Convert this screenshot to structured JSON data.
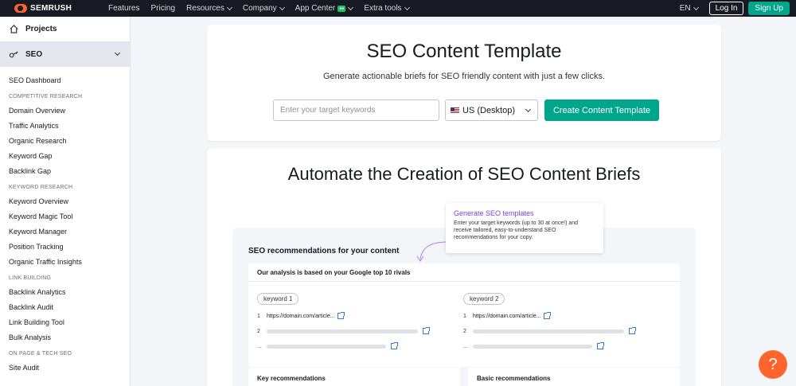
{
  "topnav": {
    "logo_text": "SEMRUSH",
    "items": [
      {
        "label": "Features",
        "dropdown": false
      },
      {
        "label": "Pricing",
        "dropdown": false
      },
      {
        "label": "Resources",
        "dropdown": true
      },
      {
        "label": "Company",
        "dropdown": true
      },
      {
        "label": "App Center",
        "dropdown": true
      },
      {
        "label": "Extra tools",
        "dropdown": true
      }
    ],
    "language": "EN",
    "login_label": "Log In",
    "signup_label": "Sign Up"
  },
  "sidebar": {
    "projects_label": "Projects",
    "seo_label": "SEO",
    "items": [
      {
        "type": "item",
        "label": "SEO Dashboard"
      },
      {
        "type": "heading",
        "label": "COMPETITIVE RESEARCH"
      },
      {
        "type": "item",
        "label": "Domain Overview"
      },
      {
        "type": "item",
        "label": "Traffic Analytics"
      },
      {
        "type": "item",
        "label": "Organic Research"
      },
      {
        "type": "item",
        "label": "Keyword Gap"
      },
      {
        "type": "item",
        "label": "Backlink Gap"
      },
      {
        "type": "heading",
        "label": "KEYWORD RESEARCH"
      },
      {
        "type": "item",
        "label": "Keyword Overview"
      },
      {
        "type": "item",
        "label": "Keyword Magic Tool"
      },
      {
        "type": "item",
        "label": "Keyword Manager"
      },
      {
        "type": "item",
        "label": "Position Tracking"
      },
      {
        "type": "item",
        "label": "Organic Traffic Insights"
      },
      {
        "type": "heading",
        "label": "LINK BUILDING"
      },
      {
        "type": "item",
        "label": "Backlink Analytics"
      },
      {
        "type": "item",
        "label": "Backlink Audit"
      },
      {
        "type": "item",
        "label": "Link Building Tool"
      },
      {
        "type": "item",
        "label": "Bulk Analysis"
      },
      {
        "type": "heading",
        "label": "ON PAGE & TECH SEO"
      },
      {
        "type": "item",
        "label": "Site Audit"
      }
    ]
  },
  "hero": {
    "title": "SEO Content Template",
    "subtitle": "Generate actionable briefs for SEO friendly content with just a few clicks.",
    "keyword_placeholder": "Enter your target keywords",
    "region_value": "US (Desktop)",
    "create_label": "Create Content Template"
  },
  "promo": {
    "title": "Automate the Creation of SEO Content Briefs",
    "illustration_title": "SEO recommendations for your content",
    "tooltip_title": "Generate SEO templates",
    "tooltip_body": "Enter your target keywords (up to 30 at once!) and receive tailored, easy-to-understand SEO recommendations for your copy.",
    "panel_title": "Our analysis is based on your Google top 10 rivals",
    "keyword1": "keyword 1",
    "keyword2": "keyword 2",
    "row1_num": "1",
    "row2_num": "2",
    "row3_num": "...",
    "url1": "https://domain.com/article...",
    "url2": "https://domain.com/article...",
    "key_recs": "Key recommendations",
    "basic_recs": "Basic recommendations"
  },
  "help_label": "?"
}
